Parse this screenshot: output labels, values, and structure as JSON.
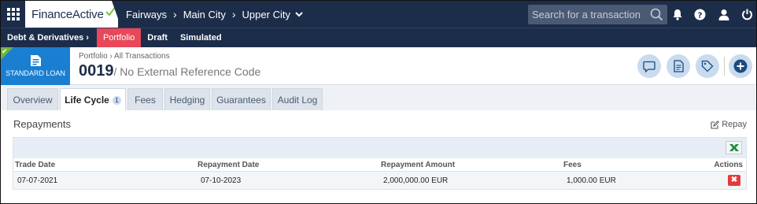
{
  "topbar": {
    "brand": "FinanceActive",
    "breadcrumbs": [
      "Fairways",
      "Main City",
      "Upper City"
    ],
    "search_placeholder": "Search for a transaction",
    "icons": [
      "apps-grid-icon",
      "search-icon",
      "bell-icon",
      "help-icon",
      "user-icon",
      "power-icon"
    ]
  },
  "subnav": {
    "items": [
      {
        "label": "Debt & Derivatives ›"
      },
      {
        "label": "Portfolio",
        "active": true
      },
      {
        "label": "Draft"
      },
      {
        "label": "Simulated"
      }
    ]
  },
  "header": {
    "badge_label": "STANDARD LOAN",
    "path": "Portfolio › All Transactions",
    "code": "0019",
    "reference": "/ No External Reference Code",
    "actions": [
      "comment-icon",
      "document-icon",
      "tag-icon",
      "add-icon"
    ]
  },
  "tabs": [
    {
      "label": "Overview"
    },
    {
      "label": "Life Cycle",
      "count": "1",
      "active": true
    },
    {
      "label": "Fees"
    },
    {
      "label": "Hedging"
    },
    {
      "label": "Guarantees"
    },
    {
      "label": "Audit Log"
    }
  ],
  "repayments": {
    "title": "Repayments",
    "repay_label": "Repay",
    "columns": [
      "Trade Date",
      "Repayment Date",
      "Repayment Amount",
      "Fees",
      "Actions"
    ],
    "rows": [
      {
        "trade_date": "07-07-2021",
        "repayment_date": "07-10-2023",
        "amount": "2,000,000.00 EUR",
        "fees": "1,000.00 EUR"
      }
    ]
  },
  "colors": {
    "navy": "#1c2d4a",
    "active_red": "#e8485a",
    "badge_blue": "#1a7fd1",
    "badge_green": "#73b43a",
    "delete_red": "#e63a3a",
    "excel_green": "#1e8a3c"
  }
}
